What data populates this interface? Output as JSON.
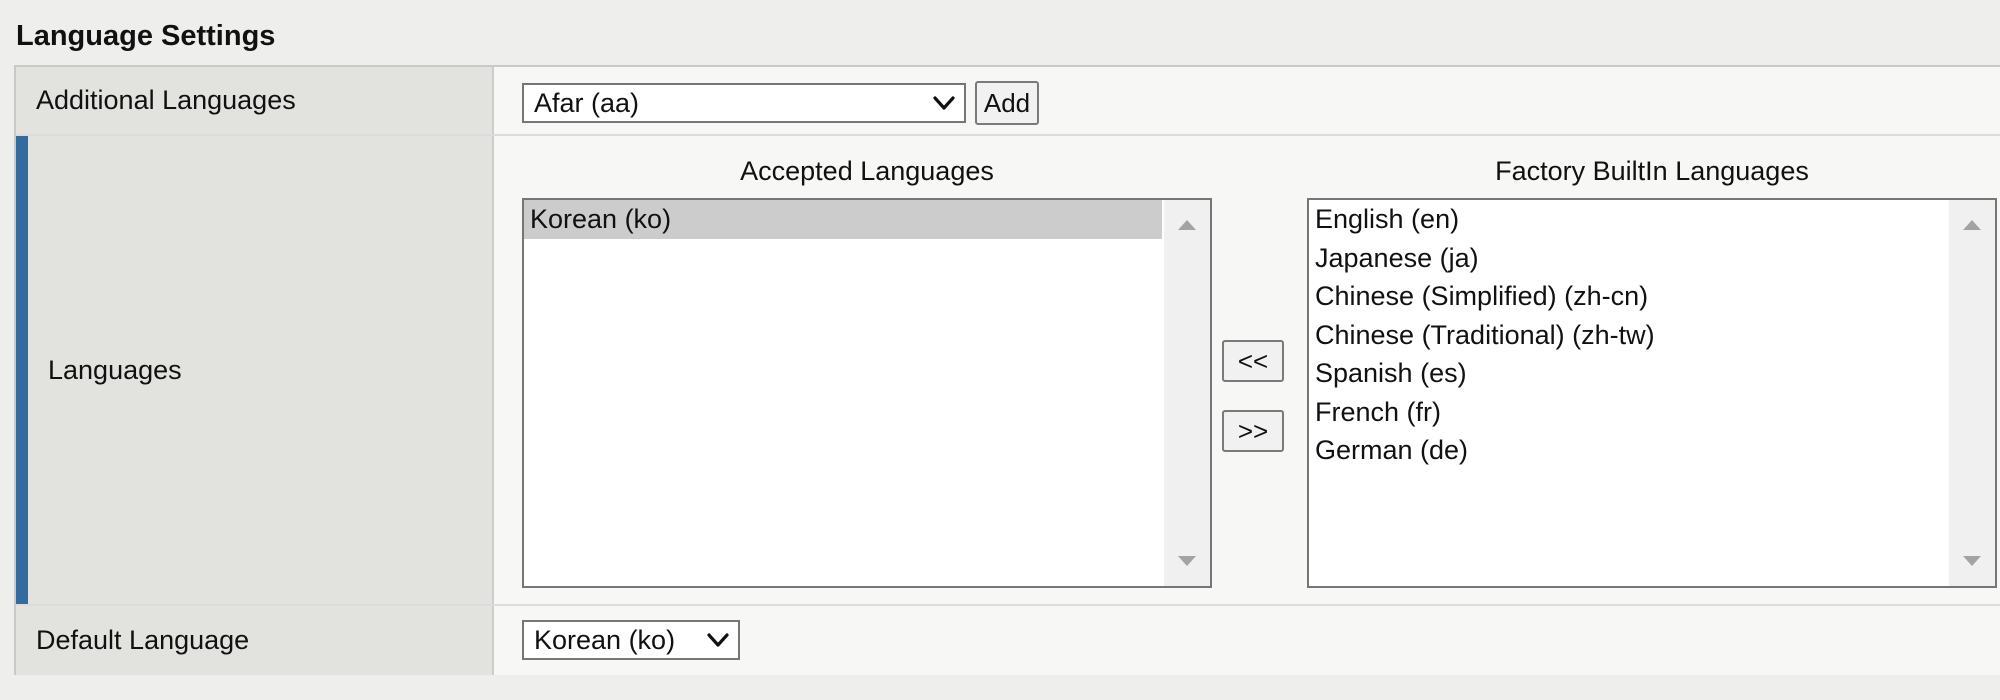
{
  "section": {
    "title": "Language Settings"
  },
  "additional_languages": {
    "label": "Additional Languages",
    "selected": "Afar (aa)",
    "add_label": "Add"
  },
  "languages": {
    "label": "Languages",
    "accepted": {
      "caption": "Accepted Languages",
      "items": [
        "Korean (ko)"
      ],
      "selected_index": 0
    },
    "factory": {
      "caption": "Factory BuiltIn Languages",
      "items": [
        "English (en)",
        "Japanese (ja)",
        "Chinese (Simplified) (zh-cn)",
        "Chinese (Traditional) (zh-tw)",
        "Spanish (es)",
        "French (fr)",
        "German (de)"
      ]
    },
    "move_left_label": "<<",
    "move_right_label": ">>"
  },
  "default_language": {
    "label": "Default Language",
    "selected": "Korean (ko)"
  },
  "colors": {
    "accent_bar": "#336b9e",
    "label_bg": "#e2e2df",
    "selected_item_bg": "#cccccc"
  }
}
